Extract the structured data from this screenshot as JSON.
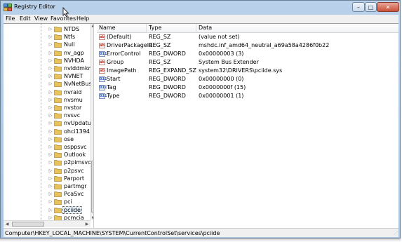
{
  "window": {
    "title": "Registry Editor"
  },
  "title_controls": {
    "minimize_glyph": "–",
    "maximize_glyph": "□",
    "close_glyph": "✕"
  },
  "menu": [
    "File",
    "Edit",
    "View",
    "Favorites",
    "Help"
  ],
  "tree": {
    "items": [
      {
        "label": "NTDS"
      },
      {
        "label": "Ntfs"
      },
      {
        "label": "Null"
      },
      {
        "label": "nv_agp"
      },
      {
        "label": "NVHDA"
      },
      {
        "label": "nvlddmkm"
      },
      {
        "label": "NVNET"
      },
      {
        "label": "NvNetBus"
      },
      {
        "label": "nvraid"
      },
      {
        "label": "nvsmu"
      },
      {
        "label": "nvstor"
      },
      {
        "label": "nvsvc"
      },
      {
        "label": "nvUpdatus"
      },
      {
        "label": "ohci1394"
      },
      {
        "label": "ose"
      },
      {
        "label": "osppsvc"
      },
      {
        "label": "Outlook"
      },
      {
        "label": "p2pimsvc"
      },
      {
        "label": "p2psvc"
      },
      {
        "label": "Parport"
      },
      {
        "label": "partmgr"
      },
      {
        "label": "PcaSvc"
      },
      {
        "label": "pci"
      },
      {
        "label": "pciide",
        "selected": true
      },
      {
        "label": "pcmcia"
      }
    ],
    "expander_glyph": "▷"
  },
  "columns": {
    "name": "Name",
    "type": "Type",
    "data": "Data"
  },
  "values": [
    {
      "icon": "string-value-icon",
      "name": "(Default)",
      "type": "REG_SZ",
      "data": "(value not set)"
    },
    {
      "icon": "string-value-icon",
      "name": "DriverPackageId",
      "type": "REG_SZ",
      "data": "mshdc.inf_amd64_neutral_a69a58a4286f0b22"
    },
    {
      "icon": "dword-value-icon",
      "name": "ErrorControl",
      "type": "REG_DWORD",
      "data": "0x00000003 (3)"
    },
    {
      "icon": "string-value-icon",
      "name": "Group",
      "type": "REG_SZ",
      "data": "System Bus Extender"
    },
    {
      "icon": "string-value-icon",
      "name": "ImagePath",
      "type": "REG_EXPAND_SZ",
      "data": "system32\\DRIVERS\\pciide.sys"
    },
    {
      "icon": "dword-value-icon",
      "name": "Start",
      "type": "REG_DWORD",
      "data": "0x00000000 (0)"
    },
    {
      "icon": "dword-value-icon",
      "name": "Tag",
      "type": "REG_DWORD",
      "data": "0x0000000f (15)"
    },
    {
      "icon": "dword-value-icon",
      "name": "Type",
      "type": "REG_DWORD",
      "data": "0x00000001 (1)"
    }
  ],
  "value_icon_glyphs": {
    "sz": "ab",
    "dword": "011"
  },
  "statusbar": {
    "path": "Computer\\HKEY_LOCAL_MACHINE\\SYSTEM\\CurrentControlSet\\services\\pciide"
  },
  "colors": {
    "title_bar": "#b9d1ea",
    "close_button": "#c8503a",
    "folder": "#e8c25a",
    "selection": "#e5f0fb"
  }
}
